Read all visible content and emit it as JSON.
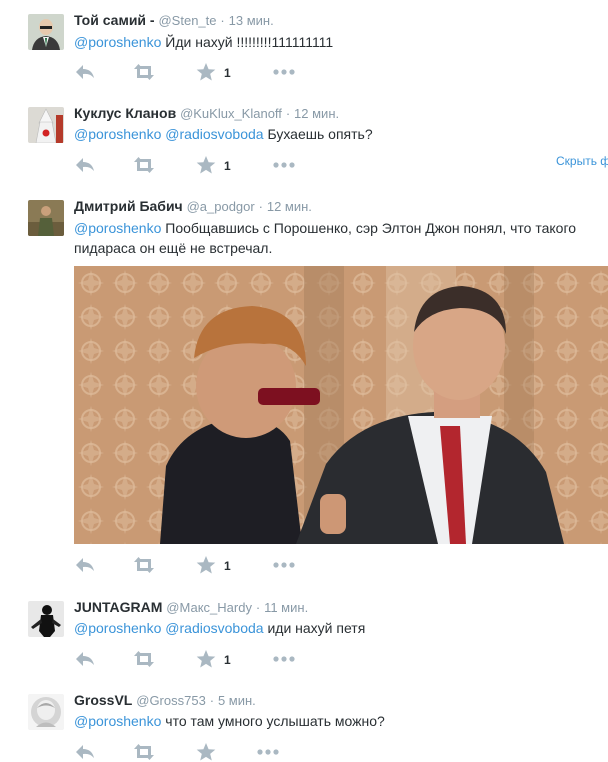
{
  "tweets": [
    {
      "name": "Той самий -",
      "handle": "@Sten_te",
      "time": "13 мин.",
      "mentions": [
        "@poroshenko"
      ],
      "text": "Йди нахуй !!!!!!!!!111111111",
      "favorites": "1"
    },
    {
      "name": "Куклус Кланов",
      "handle": "@KuKlux_Klanoff",
      "time": "12 мин.",
      "mentions": [
        "@poroshenko",
        "@radiosvoboda"
      ],
      "text": "Бухаешь опять?",
      "favorites": "1",
      "hide_label": "Скрыть ф"
    },
    {
      "name": "Дмитрий Бабич",
      "handle": "@a_podgor",
      "time": "12 мин.",
      "mentions": [
        "@poroshenko"
      ],
      "text": "Пообщавшись с Порошенко, сэр Элтон Джон понял, что такого пидараса он ещё не встречал.",
      "favorites": "1"
    },
    {
      "name": "JUNTAGRAM",
      "handle": "@Макс_Hardy",
      "time": "11 мин.",
      "mentions": [
        "@poroshenko",
        "@radiosvoboda"
      ],
      "text": "иди нахуй петя",
      "favorites": "1"
    },
    {
      "name": "GrossVL",
      "handle": "@Gross753",
      "time": "5 мин.",
      "mentions": [
        "@poroshenko"
      ],
      "text": "что там умного услышать можно?"
    }
  ],
  "separator": "·",
  "icons": [
    "reply-icon",
    "retweet-icon",
    "favorite-icon",
    "more-icon"
  ],
  "colors": {
    "link": "#3b94d9",
    "muted": "#8899a6",
    "icon": "#aab8c2",
    "text": "#292f33",
    "divider": "#e1e8ed"
  }
}
